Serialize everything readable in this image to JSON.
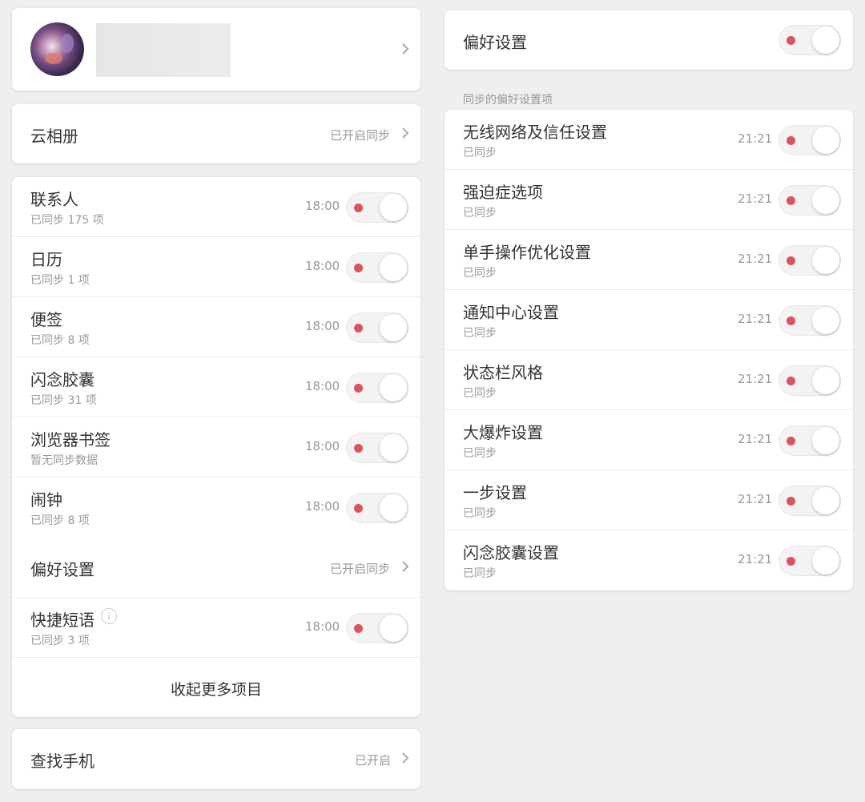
{
  "profile": {
    "avatar": "avatar",
    "name": ""
  },
  "cloud_album": {
    "label": "云相册",
    "status": "已开启同步"
  },
  "sync_items": [
    {
      "label": "联系人",
      "sub": "已同步 175 项",
      "time": "18:00",
      "on": true
    },
    {
      "label": "日历",
      "sub": "已同步 1 项",
      "time": "18:00",
      "on": true
    },
    {
      "label": "便签",
      "sub": "已同步 8 项",
      "time": "18:00",
      "on": true
    },
    {
      "label": "闪念胶囊",
      "sub": "已同步 31 项",
      "time": "18:00",
      "on": true
    },
    {
      "label": "浏览器书签",
      "sub": "暂无同步数据",
      "time": "18:00",
      "on": true
    },
    {
      "label": "闹钟",
      "sub": "已同步 8 项",
      "time": "18:00",
      "on": true
    }
  ],
  "pref_row": {
    "label": "偏好设置",
    "status": "已开启同步"
  },
  "quick_phrase": {
    "label": "快捷短语",
    "info_icon": "i",
    "sub": "已同步 3 项",
    "time": "18:00",
    "on": true
  },
  "collapse_label": "收起更多项目",
  "find_phone": {
    "label": "查找手机",
    "status": "已开启"
  },
  "right": {
    "preferences": {
      "label": "偏好设置",
      "on": true
    },
    "section_label": "同步的偏好设置项",
    "items": [
      {
        "label": "无线网络及信任设置",
        "sub": "已同步",
        "time": "21:21",
        "on": true
      },
      {
        "label": "强迫症选项",
        "sub": "已同步",
        "time": "21:21",
        "on": true
      },
      {
        "label": "单手操作优化设置",
        "sub": "已同步",
        "time": "21:21",
        "on": true
      },
      {
        "label": "通知中心设置",
        "sub": "已同步",
        "time": "21:21",
        "on": true
      },
      {
        "label": "状态栏风格",
        "sub": "已同步",
        "time": "21:21",
        "on": true
      },
      {
        "label": "大爆炸设置",
        "sub": "已同步",
        "time": "21:21",
        "on": true
      },
      {
        "label": "一步设置",
        "sub": "已同步",
        "time": "21:21",
        "on": true
      },
      {
        "label": "闪念胶囊设置",
        "sub": "已同步",
        "time": "21:21",
        "on": true
      }
    ]
  },
  "colors": {
    "background": "#efefef",
    "card": "#ffffff",
    "toggle_dot": "#d9545e",
    "secondary_text": "#999999"
  }
}
